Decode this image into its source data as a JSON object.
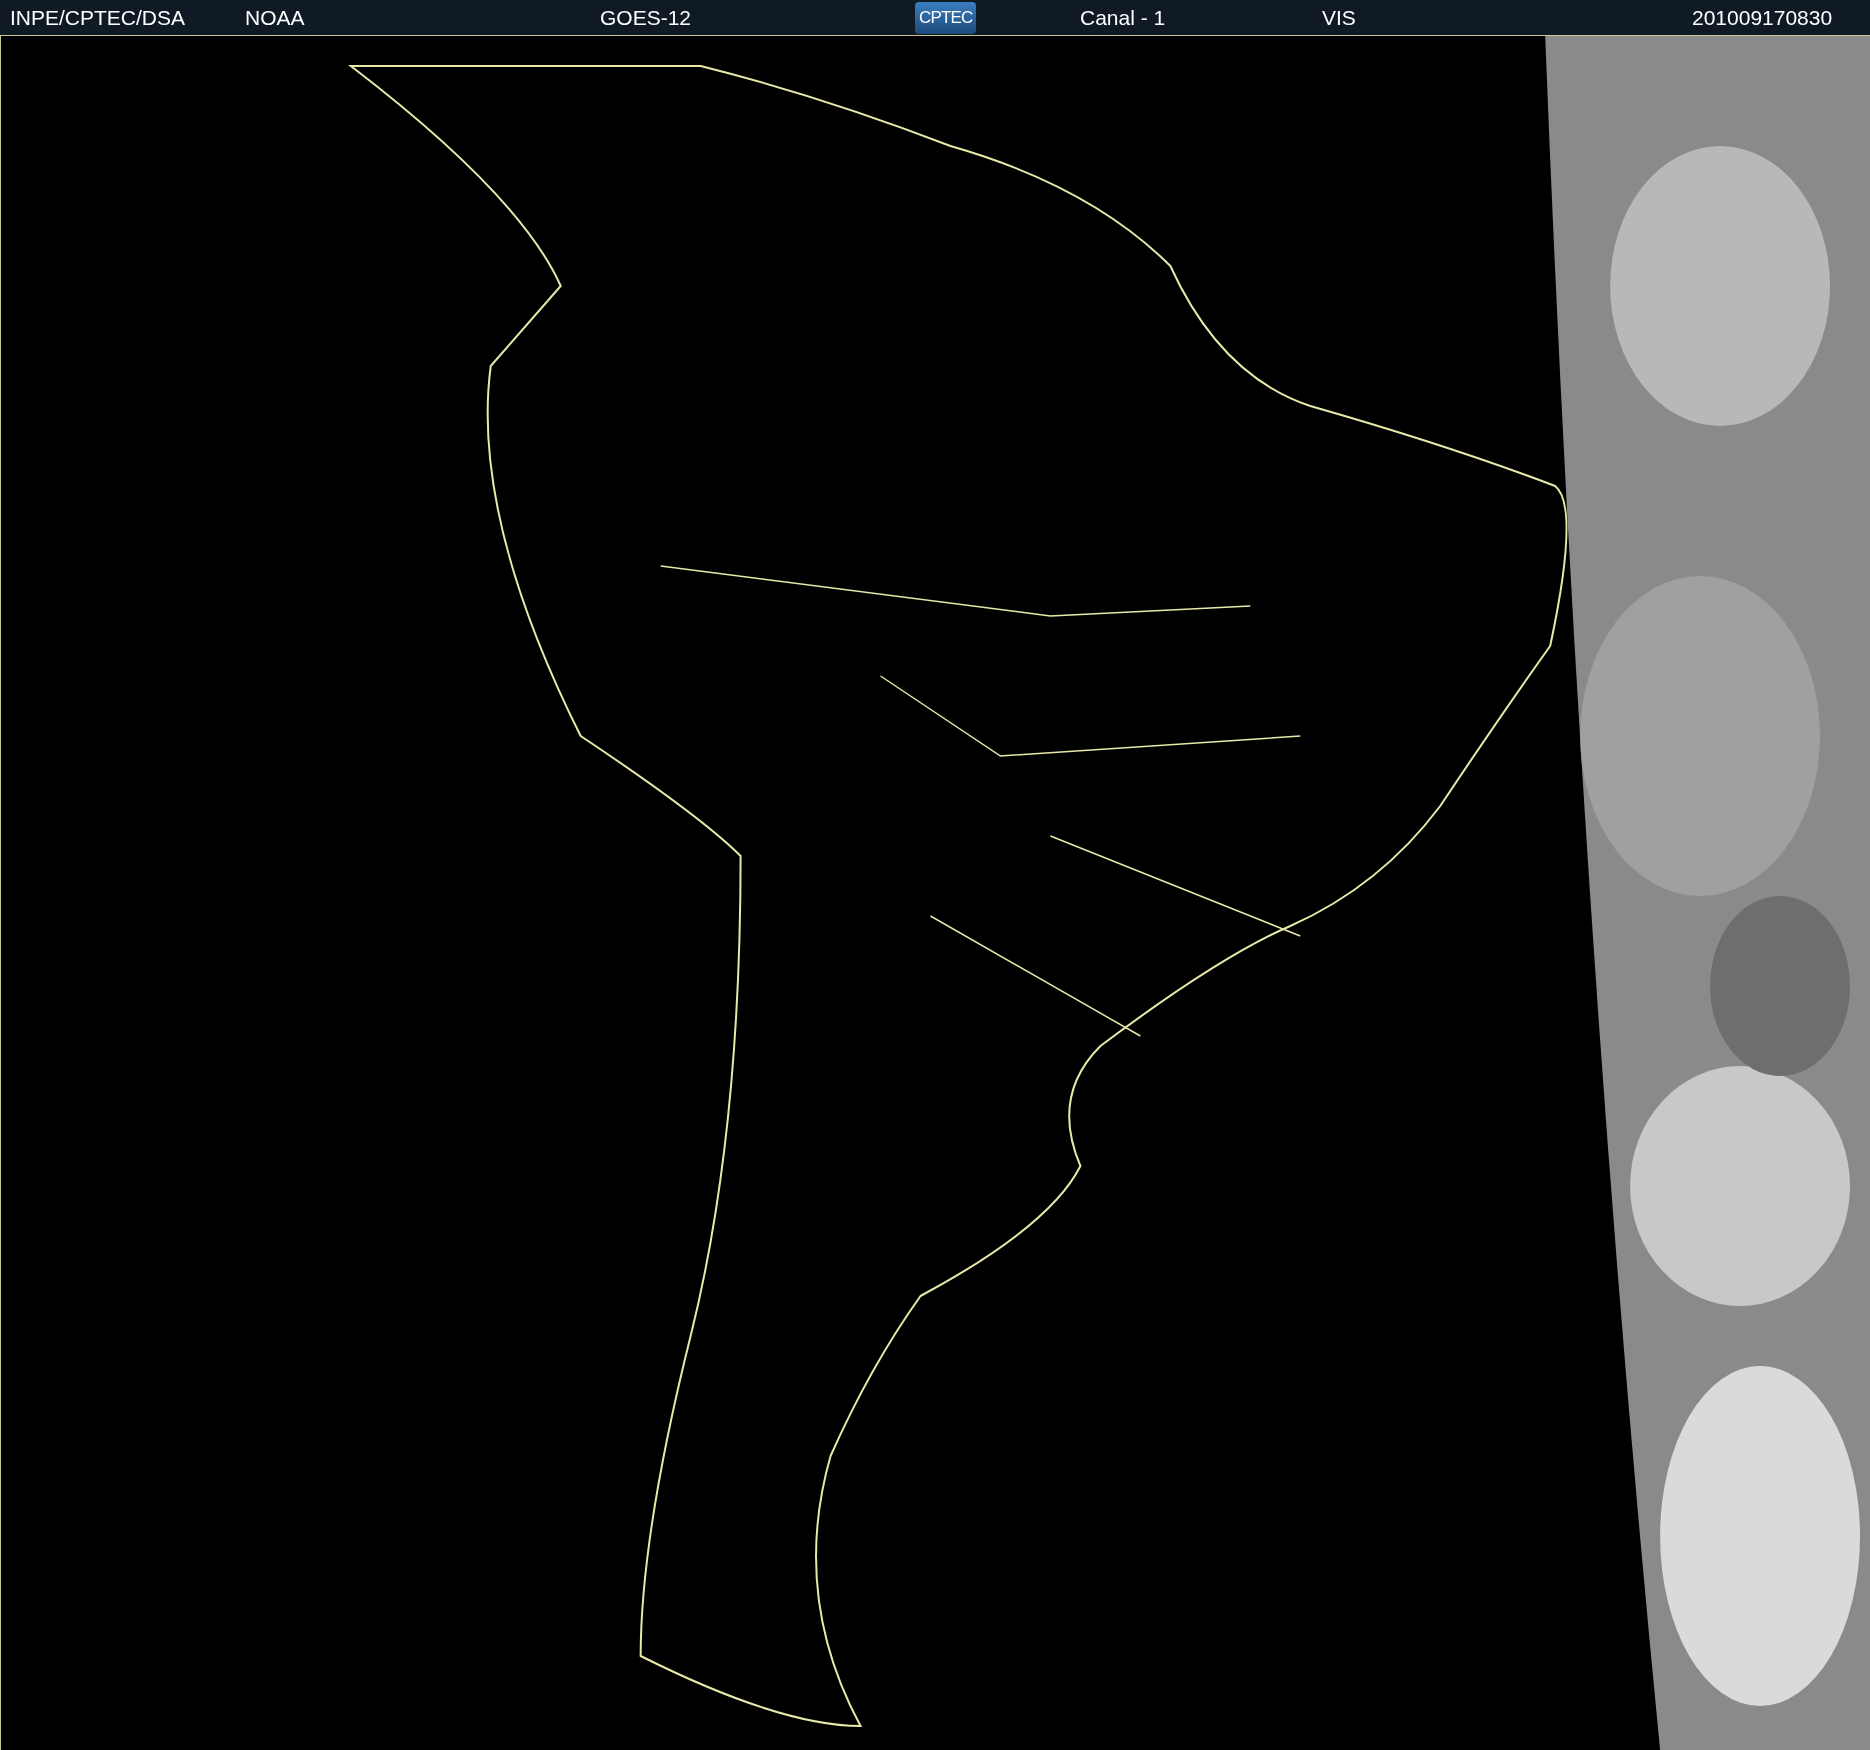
{
  "header": {
    "items": [
      {
        "kind": "text",
        "label": "INPE/CPTEC/DSA"
      },
      {
        "kind": "text",
        "label": "NOAA"
      },
      {
        "kind": "text",
        "label": "GOES-12"
      },
      {
        "kind": "logo",
        "label": "CPTEC"
      },
      {
        "kind": "text",
        "label": "Canal - 1"
      },
      {
        "kind": "text",
        "label": "VIS"
      },
      {
        "kind": "text",
        "label": "201009170830"
      }
    ]
  }
}
